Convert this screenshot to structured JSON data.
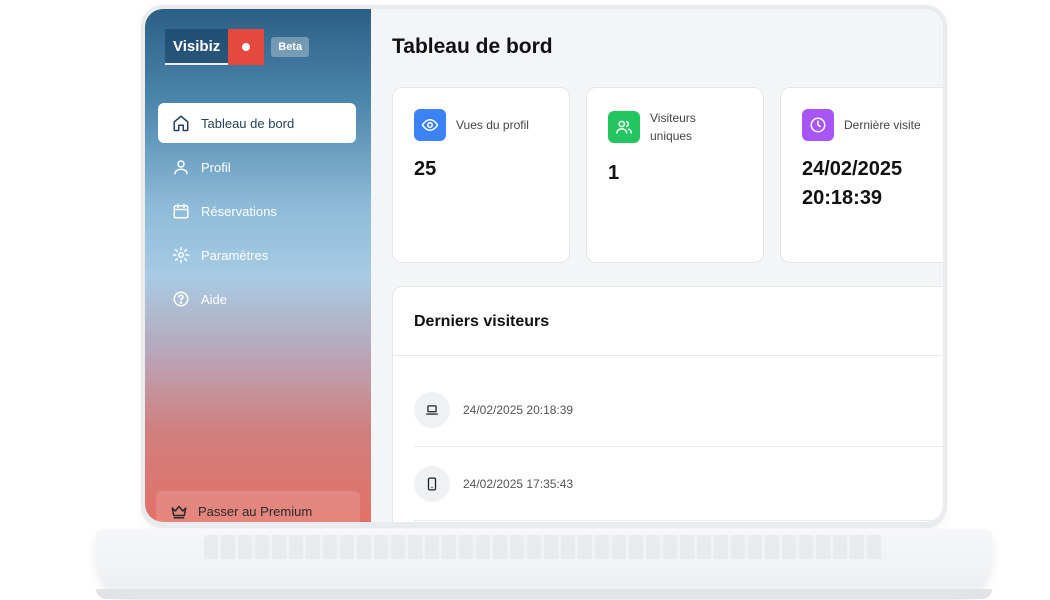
{
  "brand": {
    "name": "Visibiz",
    "badge": "Beta"
  },
  "sidebar": {
    "items": [
      {
        "label": "Tableau de bord",
        "icon": "home-icon",
        "active": true
      },
      {
        "label": "Profil",
        "icon": "user-icon",
        "active": false
      },
      {
        "label": "Réservations",
        "icon": "calendar-icon",
        "active": false
      },
      {
        "label": "Paramètres",
        "icon": "gear-icon",
        "active": false
      },
      {
        "label": "Aide",
        "icon": "help-icon",
        "active": false
      }
    ],
    "premium_label": "Passer au Premium"
  },
  "main": {
    "title": "Tableau de bord",
    "cards": [
      {
        "label": "Vues du profil",
        "value": "25",
        "icon": "eye-icon",
        "color": "#3b82f6"
      },
      {
        "label": "Visiteurs uniques",
        "value": "1",
        "icon": "users-icon",
        "color": "#22c55e"
      },
      {
        "label": "Dernière visite",
        "value": "24/02/2025 20:18:39",
        "icon": "clock-icon",
        "color": "#a855f7"
      }
    ],
    "visitors": {
      "title": "Derniers visiteurs",
      "rows": [
        {
          "time": "24/02/2025 20:18:39",
          "device": "laptop-icon"
        },
        {
          "time": "24/02/2025 17:35:43",
          "device": "phone-icon"
        }
      ]
    }
  },
  "colors": {
    "accent_red": "#e5483d",
    "text_dark": "#111111"
  }
}
